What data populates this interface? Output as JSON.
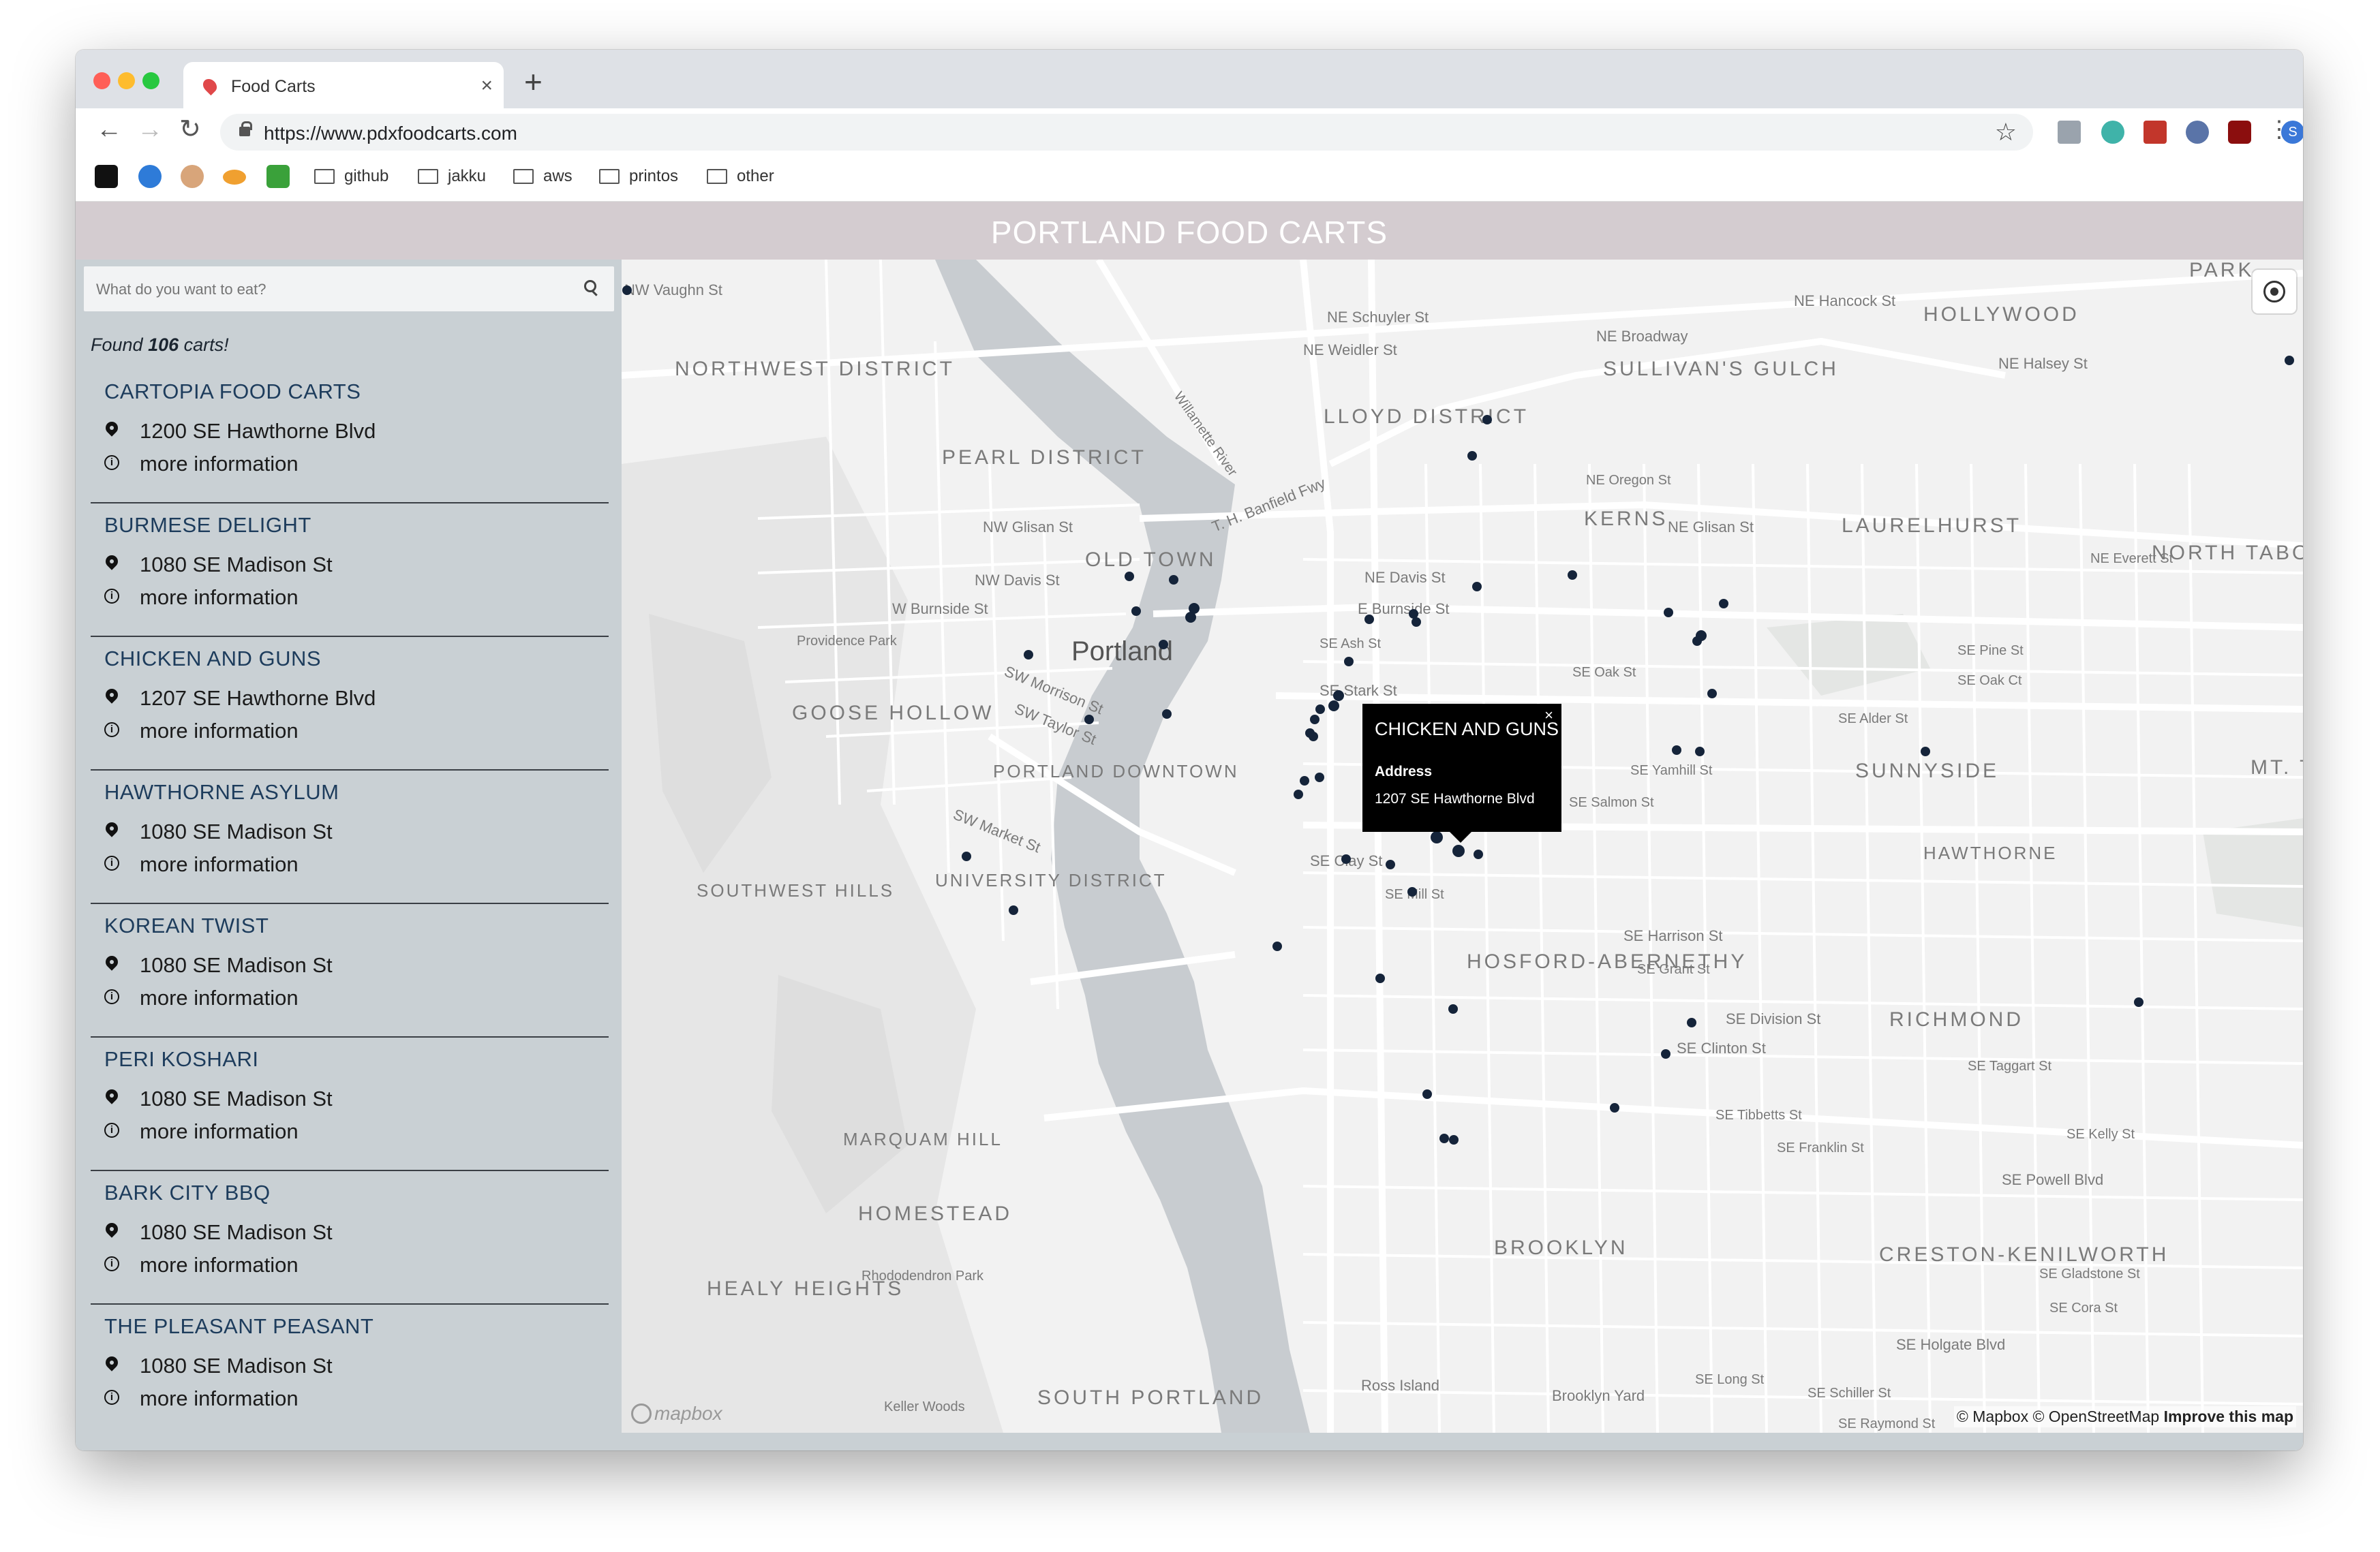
{
  "browser": {
    "tab_title": "Food Carts",
    "tab_close": "×",
    "new_tab": "+",
    "url": "https://www.pdxfoodcarts.com",
    "back": "←",
    "forward": "→",
    "reload": "↻",
    "star": "☆",
    "menu": "⋮",
    "profile_initial": "S",
    "bookmarks": [
      "github",
      "jakku",
      "aws",
      "printos",
      "other"
    ]
  },
  "app": {
    "title": "PORTLAND FOOD CARTS",
    "search_placeholder": "What do you want to eat?",
    "found_prefix": "Found ",
    "found_count": "106",
    "found_suffix": " carts!",
    "more_info_label": "more information",
    "carts": [
      {
        "name": "CARTOPIA FOOD CARTS",
        "address": "1200 SE Hawthorne Blvd"
      },
      {
        "name": "BURMESE DELIGHT",
        "address": "1080 SE Madison St"
      },
      {
        "name": "CHICKEN AND GUNS",
        "address": "1207 SE Hawthorne Blvd"
      },
      {
        "name": "HAWTHORNE ASYLUM",
        "address": "1080 SE Madison St"
      },
      {
        "name": "KOREAN TWIST",
        "address": "1080 SE Madison St"
      },
      {
        "name": "PERI KOSHARI",
        "address": "1080 SE Madison St"
      },
      {
        "name": "BARK CITY BBQ",
        "address": "1080 SE Madison St"
      },
      {
        "name": "THE PLEASANT PEASANT",
        "address": "1080 SE Madison St"
      }
    ]
  },
  "map": {
    "popup": {
      "title": "CHICKEN AND GUNS",
      "address_label": "Address",
      "address": "1207 SE Hawthorne Blvd",
      "close": "×"
    },
    "attribution": "© Mapbox © OpenStreetMap",
    "improve": "Improve this map",
    "logo": "mapbox",
    "city_label": "Portland",
    "neighborhoods": [
      "NORTHWEST DISTRICT",
      "PEARL DISTRICT",
      "OLD TOWN",
      "GOOSE HOLLOW",
      "PORTLAND DOWNTOWN",
      "UNIVERSITY DISTRICT",
      "SOUTHWEST HILLS",
      "MARQUAM HILL",
      "HOMESTEAD",
      "HEALY HEIGHTS",
      "SOUTH PORTLAND",
      "LLOYD DISTRICT",
      "KERNS",
      "SULLIVAN'S GULCH",
      "HOLLYWOOD",
      "LAURELHURST",
      "NORTH TABOR",
      "SUNNYSIDE",
      "HAWTHORNE",
      "HOSFORD-ABERNETHY",
      "RICHMOND",
      "BROOKLYN",
      "CRESTON-KENILWORTH",
      "PARK",
      "MT. T"
    ],
    "streets": [
      "NW Vaughn St",
      "NE Schuyler St",
      "NE Weidler St",
      "NE Broadway",
      "NE Halsey St",
      "NE Hancock St",
      "NW Glisan St",
      "NW Davis St",
      "W Burnside St",
      "E Burnside St",
      "NE Davis St",
      "NE Glisan St",
      "SE Stark St",
      "SE Ash St",
      "SE Oak St",
      "SE Yamhill St",
      "SE Salmon St",
      "SE Clay St",
      "SE Mill St",
      "SE Harrison St",
      "SE Grant St",
      "SE Division St",
      "SE Clinton St",
      "SE Tibbetts St",
      "SE Franklin St",
      "SE Powell Blvd",
      "SE Holgate Blvd",
      "SE Long St",
      "SE Alder St",
      "SE Pine St",
      "SE Oak Ct",
      "Providence Park",
      "Rhododendron Park",
      "Ross Island",
      "Brooklyn Yard",
      "Keller Woods",
      "T. H. Banfield Fwy",
      "Willamette River",
      "SW Morrison St",
      "SW Taylor St",
      "SW Market St",
      "SE Taggart St",
      "SE Kelly St",
      "SE Gladstone St",
      "SE Cora St",
      "SE Schiller St",
      "SE Raymond St",
      "NE Oregon St",
      "NE Everett St"
    ]
  },
  "colors": {
    "header_bg": "#d4ccd0",
    "sidebar_bg": "#c9d0d4",
    "cart_name": "#1d3c5c",
    "marker": "#15243a",
    "river": "#c8ccd0"
  }
}
